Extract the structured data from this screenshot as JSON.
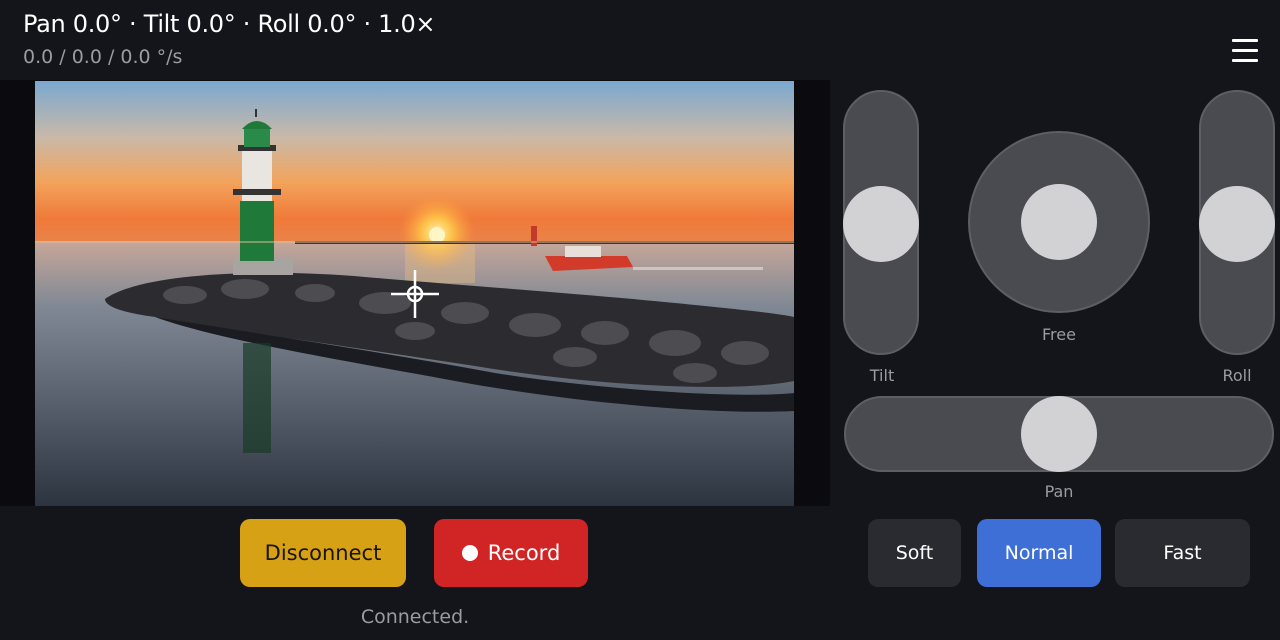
{
  "header": {
    "position_readout": "Pan 0.0° · Tilt 0.0° · Roll 0.0° · 1.0×",
    "speed_readout": "0.0 / 0.0 / 0.0 °/s"
  },
  "menu": {
    "icon": "hamburger-menu-icon"
  },
  "video": {
    "crosshair_icon": "crosshair-icon"
  },
  "actions": {
    "disconnect_label": "Disconnect",
    "record_label": "Record",
    "connection_status": "Connected."
  },
  "controls": {
    "tilt": {
      "label": "Tilt",
      "value": 0.0
    },
    "roll": {
      "label": "Roll",
      "value": 0.0
    },
    "free": {
      "label": "Free",
      "x": 0.0,
      "y": 0.0
    },
    "pan": {
      "label": "Pan",
      "value": 0.0
    }
  },
  "speed_modes": {
    "options": [
      "Soft",
      "Normal",
      "Fast"
    ],
    "selected": "Normal"
  },
  "colors": {
    "background": "#14141b",
    "disconnect": "#d7a116",
    "record": "#d12525",
    "selected_mode": "#3d6fd6",
    "mode_button": "#2a2b31",
    "track": "#4a4a51",
    "knob": "#d2d2d4"
  }
}
